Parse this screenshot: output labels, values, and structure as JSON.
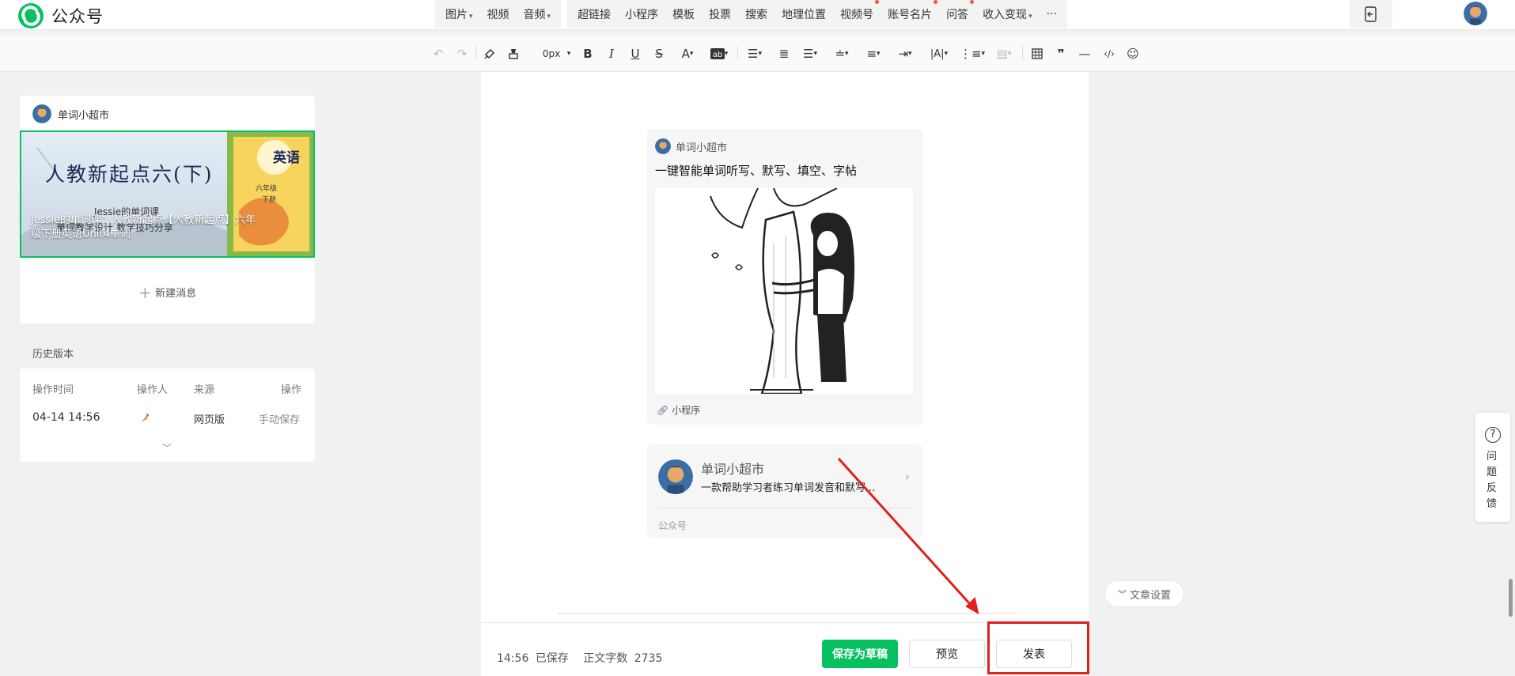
{
  "app": {
    "name": "公众号"
  },
  "top_menu": {
    "group1": [
      {
        "label": "图片",
        "caret": "▾"
      },
      {
        "label": "视频",
        "caret": ""
      },
      {
        "label": "音频",
        "caret": "▾"
      }
    ],
    "group2": [
      {
        "label": "超链接",
        "caret": "",
        "dot": false
      },
      {
        "label": "小程序",
        "caret": "",
        "dot": false
      },
      {
        "label": "模板",
        "caret": "",
        "dot": false
      },
      {
        "label": "投票",
        "caret": "",
        "dot": false
      },
      {
        "label": "搜索",
        "caret": "",
        "dot": false
      },
      {
        "label": "地理位置",
        "caret": "",
        "dot": false
      },
      {
        "label": "视频号",
        "caret": "",
        "dot": true
      },
      {
        "label": "账号名片",
        "caret": "",
        "dot": true
      },
      {
        "label": "问答",
        "caret": "",
        "dot": true
      },
      {
        "label": "收入变现",
        "caret": "▾",
        "dot": false
      }
    ],
    "more": "···"
  },
  "toolbar": {
    "font_size": "0px"
  },
  "sidebar": {
    "cover_author": "单词小超市",
    "cover_title": "Jessie的单词课：人教新起点【人教新起点】六年级下册英语Unit4单词",
    "cover_image_text": {
      "main": "人教新起点六(下)",
      "sub1": "Jessie的单词课",
      "sub2": "单词教学设计  教学技巧分享",
      "book": "英语",
      "grade": "六年级",
      "term": "下册"
    },
    "new_message_label": "新建消息",
    "history_title": "历史版本",
    "history_headers": [
      "操作时间",
      "操作人",
      "来源",
      "操作"
    ],
    "history_row": {
      "time": "04-14 14:56",
      "source": "网页版",
      "action": "手动保存"
    }
  },
  "editor": {
    "miniprogram_card": {
      "author": "单词小超市",
      "title": "一键智能单词听写、默写、填空、字帖",
      "footer": "小程序"
    },
    "account_card": {
      "name": "单词小超市",
      "desc": "一款帮助学习者练习单词发音和默写...",
      "type": "公众号"
    }
  },
  "footer": {
    "save_time": "14:56",
    "save_status": "已保存",
    "word_count_label": "正文字数",
    "word_count": "2735",
    "save_draft_label": "保存为草稿",
    "preview_label": "预览",
    "publish_label": "发表"
  },
  "right_panel": {
    "feedback_label": "问题反馈",
    "article_settings_label": "文章设置"
  },
  "colors": {
    "primary": "#07c160",
    "highlight": "#e0201b",
    "dot": "#fa5151"
  }
}
